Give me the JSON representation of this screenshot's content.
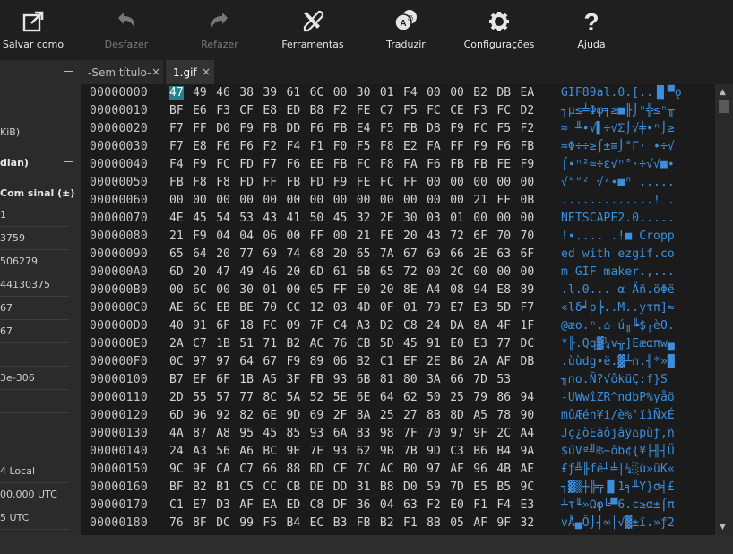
{
  "toolbar": {
    "items": [
      {
        "label": "Salvar como",
        "icon": "export-icon",
        "enabled": true
      },
      {
        "label": "Desfazer",
        "icon": "undo-icon",
        "enabled": false
      },
      {
        "label": "Refazer",
        "icon": "redo-icon",
        "enabled": false
      },
      {
        "label": "Ferramentas",
        "icon": "tools-icon",
        "enabled": true
      },
      {
        "label": "Traduzir",
        "icon": "translate-icon",
        "enabled": true
      },
      {
        "label": "Configurações",
        "icon": "gear-icon",
        "enabled": true
      },
      {
        "label": "Ajuda",
        "icon": "help-icon",
        "enabled": true
      }
    ]
  },
  "left_panel": {
    "kib": "KiB)",
    "endian": "dian)",
    "signed": "Com sinal (±)",
    "values": [
      "1",
      "3759",
      "506279",
      "44130375",
      "67",
      "67",
      "",
      "3e-306",
      ""
    ],
    "dates": [
      "4 Local",
      "00.000 UTC",
      "5 UTC"
    ]
  },
  "tabs": [
    {
      "label": "-Sem título-",
      "active": false
    },
    {
      "label": "1.gif",
      "active": true
    }
  ],
  "hex": {
    "selected": [
      0,
      0
    ],
    "rows": [
      {
        "addr": "00000000",
        "bytes": "47 49 46 38 39 61 6C 00 30 01 F4 00 00 B2 DB EA",
        "ascii": "GIF89al.0.[..▐▌▀ǫ"
      },
      {
        "addr": "00000010",
        "bytes": "BF E6 F3 CF E8 ED B8 F2 FE C7 F5 FC CE F3 FC D2",
        "ascii": "┐µ≤╧Φφ╕≥■╟⌡ⁿ╬≤ⁿ╥"
      },
      {
        "addr": "00000020",
        "bytes": "F7 FF D0 F9 FB DD F6 FB E4 F5 FB D8 F9 FC F5 F2",
        "ascii": "≈ ╨∙√▌÷√Σ⌡√╪∙ⁿ⌡≥"
      },
      {
        "addr": "00000030",
        "bytes": "F7 E8 F6 F6 F2 F4 F1 F0 F5 F8 E2 FA FF F9 F6 FB",
        "ascii": "≈Φ÷÷≥⌠±≡⌡°Γ· ∙÷√"
      },
      {
        "addr": "00000040",
        "bytes": "F4 F9 FC FD F7 F6 EE FB FC F8 FA F6 FB FB FE F9",
        "ascii": "⌠∙ⁿ²≈÷ε√ⁿ°·÷√√■∙"
      },
      {
        "addr": "00000050",
        "bytes": "FB F8 F8 FD FF FB FD F9 FE FC FF 00 00 00 00 00",
        "ascii": "√°°² √²∙■ⁿ ....."
      },
      {
        "addr": "00000060",
        "bytes": "00 00 00 00 00 00 00 00 00 00 00 00 00 21 FF 0B",
        "ascii": ".............! ."
      },
      {
        "addr": "00000070",
        "bytes": "4E 45 54 53 43 41 50 45 32 2E 30 03 01 00 00 00",
        "ascii": "NETSCAPE2.0....."
      },
      {
        "addr": "00000080",
        "bytes": "21 F9 04 04 06 00 FF 00 21 FE 20 43 72 6F 70 70",
        "ascii": "!∙.... .!■ Cropp"
      },
      {
        "addr": "00000090",
        "bytes": "65 64 20 77 69 74 68 20 65 7A 67 69 66 2E 63 6F",
        "ascii": "ed with ezgif.co"
      },
      {
        "addr": "000000A0",
        "bytes": "6D 20 47 49 46 20 6D 61 6B 65 72 00 2C 00 00 00",
        "ascii": "m GIF maker.,..."
      },
      {
        "addr": "000000B0",
        "bytes": "00 6C 00 30 01 00 05 FF E0 20 8E A4 08 94 E8 89",
        "ascii": ".l.0... α Äñ.öΦë"
      },
      {
        "addr": "000000C0",
        "bytes": "AE 6C EB BE 70 CC 12 03 4D 0F 01 79 E7 E3 5D F7",
        "ascii": "«lδ╛p╠..M..yτπ]≈"
      },
      {
        "addr": "000000D0",
        "bytes": "40 91 6F 18 FC 09 7F C4 A3 D2 C8 24 DA 8A 4F 1F",
        "ascii": "@æo.ⁿ.⌂─ú╥╚$┌èO."
      },
      {
        "addr": "000000E0",
        "bytes": "2A C7 1B 51 71 B2 AC 76 CB 5D 45 91 E0 E3 77 DC",
        "ascii": "*╟.Qq▓¼v╦]Eæαπw▄"
      },
      {
        "addr": "000000F0",
        "bytes": "0C 97 97 64 67 F9 89 06 B2 C1 EF 2E B6 2A AF DB",
        "ascii": ".ùùdg∙ë.▓┴∩.╢*»█"
      },
      {
        "addr": "00000100",
        "bytes": "B7 EF 6F 1B A5 3F FB 93 6B 81 80 3A 66 7D 53 ",
        "ascii": "╖∩o.Ñ?√ôküÇ:f}S"
      },
      {
        "addr": "00000110",
        "bytes": "2D 55 57 77 8C 5A 52 5E 6E 64 62 50 25 79 86 94",
        "ascii": "-UWwîZR^ndbP%yåö"
      },
      {
        "addr": "00000120",
        "bytes": "6D 96 92 82 6E 9D 69 2F 8A 25 27 8B 8D A5 78 90",
        "ascii": "mûÆén¥i/è%'ïìÑxÉ"
      },
      {
        "addr": "00000130",
        "bytes": "4A 87 A8 95 45 85 93 6A 83 98 7F 70 97 9F 2C A4",
        "ascii": "Jç¿òEàôjâÿ⌂pùƒ,ñ"
      },
      {
        "addr": "00000140",
        "bytes": "24 A3 56 A6 BC 9E 7E 93 62 9B 7B 9D C3 B6 B4 9A",
        "ascii": "$úVª╝₧~ôb¢{¥├╢┤Ü"
      },
      {
        "addr": "00000150",
        "bytes": "9C 9F CA C7 66 88 BD CF 7C AC B0 97 AF 96 4B AE",
        "ascii": "£ƒ╩╟fê╜╧|¼░ù»ûK«"
      },
      {
        "addr": "00000160",
        "bytes": "BF B2 B1 C5 CC CB DE DD 31 B8 D0 59 7D E5 B5 9C",
        "ascii": "┐▓▒┼╠╦▐▌1╕╨Y}σ╡£"
      },
      {
        "addr": "00000170",
        "bytes": "C1 E7 D3 AF EA ED C8 DF 36 04 63 F2 E0 F1 F4 E3",
        "ascii": "┴τ╙»Ωφ╚▀6.c≥α±⌠π"
      },
      {
        "addr": "00000180",
        "bytes": "76 8F DC 99 F5 B4 EC B3 FB B2 F1 8B 05 AF 9F 32",
        "ascii": "vÅ▄Ö⌡┤∞│√▓±ï.»ƒ2"
      }
    ]
  }
}
